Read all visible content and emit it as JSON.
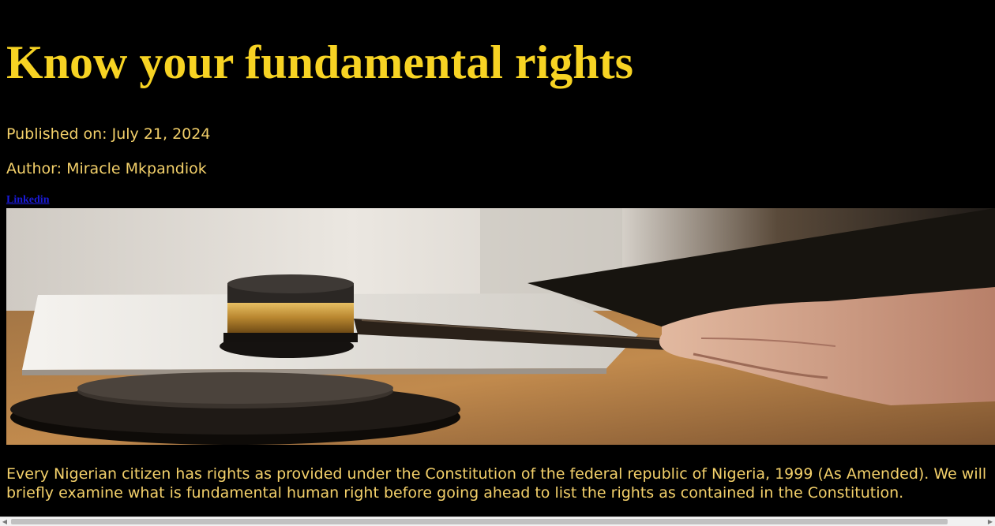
{
  "article": {
    "title": "Know your fundamental rights",
    "published": "Published on: July 21, 2024",
    "author": "Author: Miracle Mkpandiok",
    "social_link": "Linkedin",
    "hero_image_alt": "Judge's gavel on sound block",
    "intro": "Every Nigerian citizen has rights as provided under the Constitution of the federal republic of Nigeria, 1999 (As Amended). We will briefly examine what is fundamental human right before going ahead to list the rights as contained in the Constitution."
  },
  "colors": {
    "background": "#000000",
    "title": "#f7d323",
    "body_text": "#f3d06a",
    "link": "#1a1ad8"
  },
  "scrollbar": {
    "left_arrow_icon": "triangle-left-icon",
    "right_arrow_icon": "triangle-right-icon"
  }
}
